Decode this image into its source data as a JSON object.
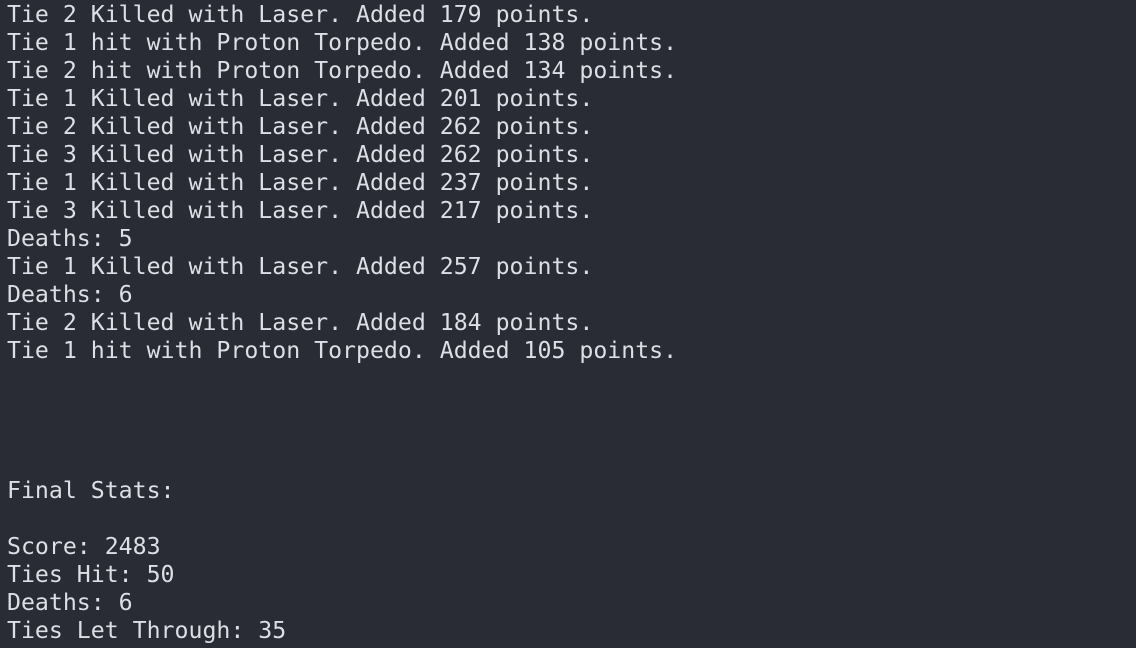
{
  "terminal": {
    "log_lines": [
      "Tie 2 Killed with Laser. Added 179 points.",
      "Tie 1 hit with Proton Torpedo. Added 138 points.",
      "Tie 2 hit with Proton Torpedo. Added 134 points.",
      "Tie 1 Killed with Laser. Added 201 points.",
      "Tie 2 Killed with Laser. Added 262 points.",
      "Tie 3 Killed with Laser. Added 262 points.",
      "Tie 1 Killed with Laser. Added 237 points.",
      "Tie 3 Killed with Laser. Added 217 points.",
      "Deaths: 5",
      "Tie 1 Killed with Laser. Added 257 points.",
      "Deaths: 6",
      "Tie 2 Killed with Laser. Added 184 points.",
      "Tie 1 hit with Proton Torpedo. Added 105 points."
    ],
    "final_stats": {
      "heading": "Final Stats:",
      "score": "Score: 2483",
      "ties_hit": "Ties Hit: 50",
      "deaths": "Deaths: 6",
      "ties_let_through": "Ties Let Through: 35"
    }
  },
  "colors": {
    "background": "#292c35",
    "text": "#dcdfe4"
  }
}
